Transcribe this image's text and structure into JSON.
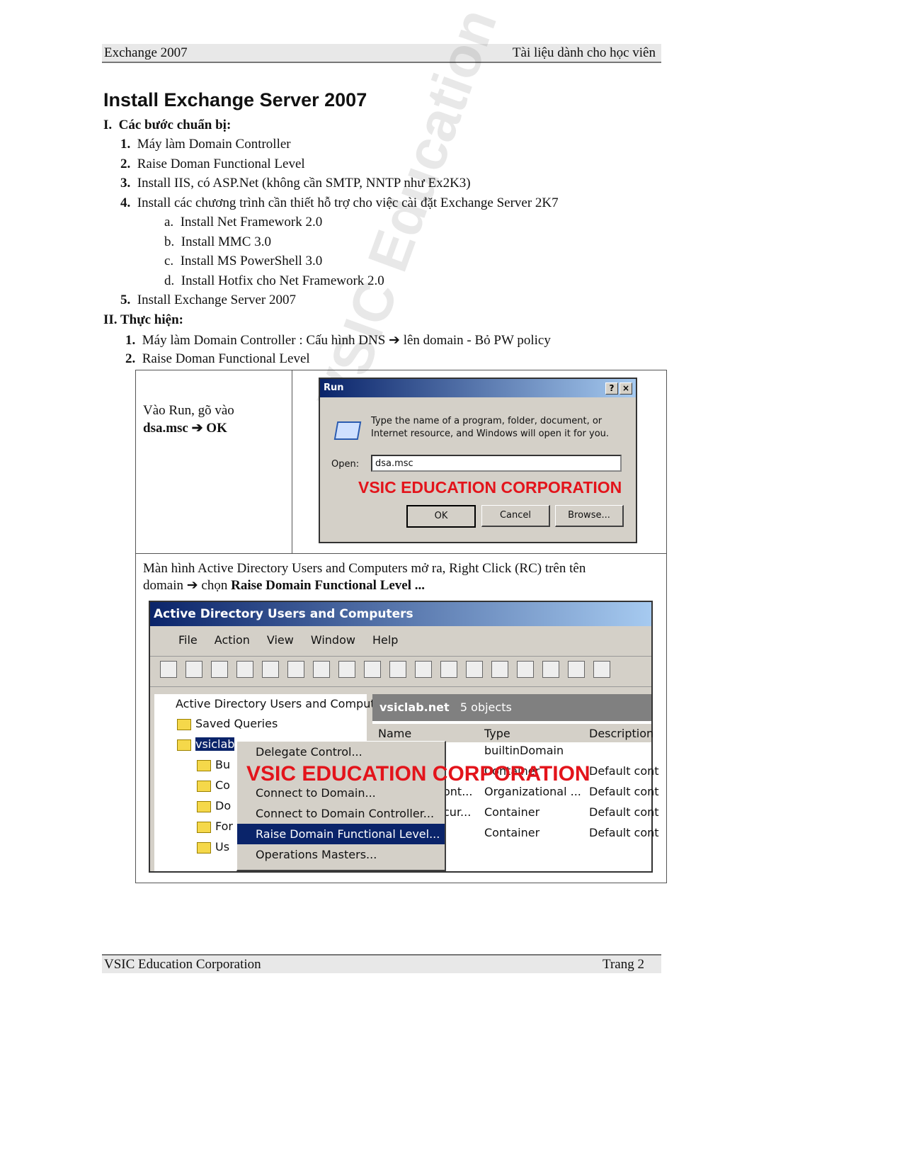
{
  "header": {
    "left": "Exchange 2007",
    "right": "Tài liệu dành cho học viên"
  },
  "title": "Install Exchange Server 2007",
  "section1": {
    "num": "I.",
    "heading": "Các bước chuẩn bị:",
    "items": [
      {
        "num": "1.",
        "text": "Máy làm Domain Controller"
      },
      {
        "num": "2.",
        "text": "Raise Doman Functional Level"
      },
      {
        "num": "3.",
        "text": "Install IIS, có ASP.Net (không cần SMTP, NNTP như Ex2K3)"
      },
      {
        "num": "4.",
        "text": "Install các chương trình cần thiết hỗ trợ cho việc cài đặt Exchange Server 2K7"
      },
      {
        "num": "5.",
        "text": "Install Exchange Server 2007"
      }
    ],
    "subitems": [
      {
        "num": "a.",
        "text": "Install Net Framework 2.0"
      },
      {
        "num": "b.",
        "text": "Install MMC 3.0"
      },
      {
        "num": "c.",
        "text": "Install MS PowerShell 3.0"
      },
      {
        "num": "d.",
        "text": "Install Hotfix cho Net Framework 2.0"
      }
    ]
  },
  "section2": {
    "num": "II.",
    "heading": "Thực hiện:",
    "items": [
      {
        "num": "1.",
        "text": "Máy làm Domain Controller : Cấu hình DNS ➔ lên domain - Bỏ PW policy"
      },
      {
        "num": "2.",
        "text": "Raise Doman Functional Level"
      }
    ]
  },
  "watermark": "VSIC Education Corporation",
  "step1": {
    "line1": "Vào Run, gõ vào",
    "bold": "dsa.msc ➔ OK"
  },
  "run_dialog": {
    "title": "Run",
    "help": "?",
    "close": "×",
    "desc1": "Type the name of a program, folder, document, or",
    "desc2": "Internet resource, and Windows will open it for you.",
    "open_label": "Open:",
    "open_value": "dsa.msc",
    "stamp": "VSIC EDUCATION CORPORATION",
    "ok": "OK",
    "cancel": "Cancel",
    "browse": "Browse..."
  },
  "step2": {
    "text1": "Màn hình Active Directory Users and Computers mở ra, Right Click (RC) trên tên",
    "text2": "domain ➔ chọn ",
    "bold": "Raise Domain Functional Level ..."
  },
  "ad_window": {
    "title": "Active Directory Users and Computers",
    "menu": [
      "File",
      "Action",
      "View",
      "Window",
      "Help"
    ],
    "tree": {
      "root": "Active Directory Users and Computer",
      "items": [
        "Saved Queries",
        "vsiclab",
        "Bu",
        "Co",
        "Do",
        "For",
        "Us"
      ]
    },
    "pane_title": "vsiclab.net",
    "pane_count": "5 objects",
    "columns": [
      "Name",
      "Type",
      "Description"
    ],
    "rows": [
      {
        "name": "",
        "type": "builtinDomain",
        "desc": ""
      },
      {
        "name": "",
        "type": "Container",
        "desc": "Default cont"
      },
      {
        "name": "ont...",
        "type": "Organizational ...",
        "desc": "Default cont"
      },
      {
        "name": "cur...",
        "type": "Container",
        "desc": "Default cont"
      },
      {
        "name": "",
        "type": "Container",
        "desc": "Default cont"
      }
    ],
    "context_menu": [
      "Delegate Control...",
      "",
      "Connect to Domain...",
      "Connect to Domain Controller...",
      "Raise Domain Functional Level...",
      "Operations Masters..."
    ],
    "selected": "Raise Domain Functional Level...",
    "stamp": "VSIC EDUCATION CORPORATION"
  },
  "footer": {
    "left": "VSIC Education Corporation",
    "right": "Trang 2"
  }
}
